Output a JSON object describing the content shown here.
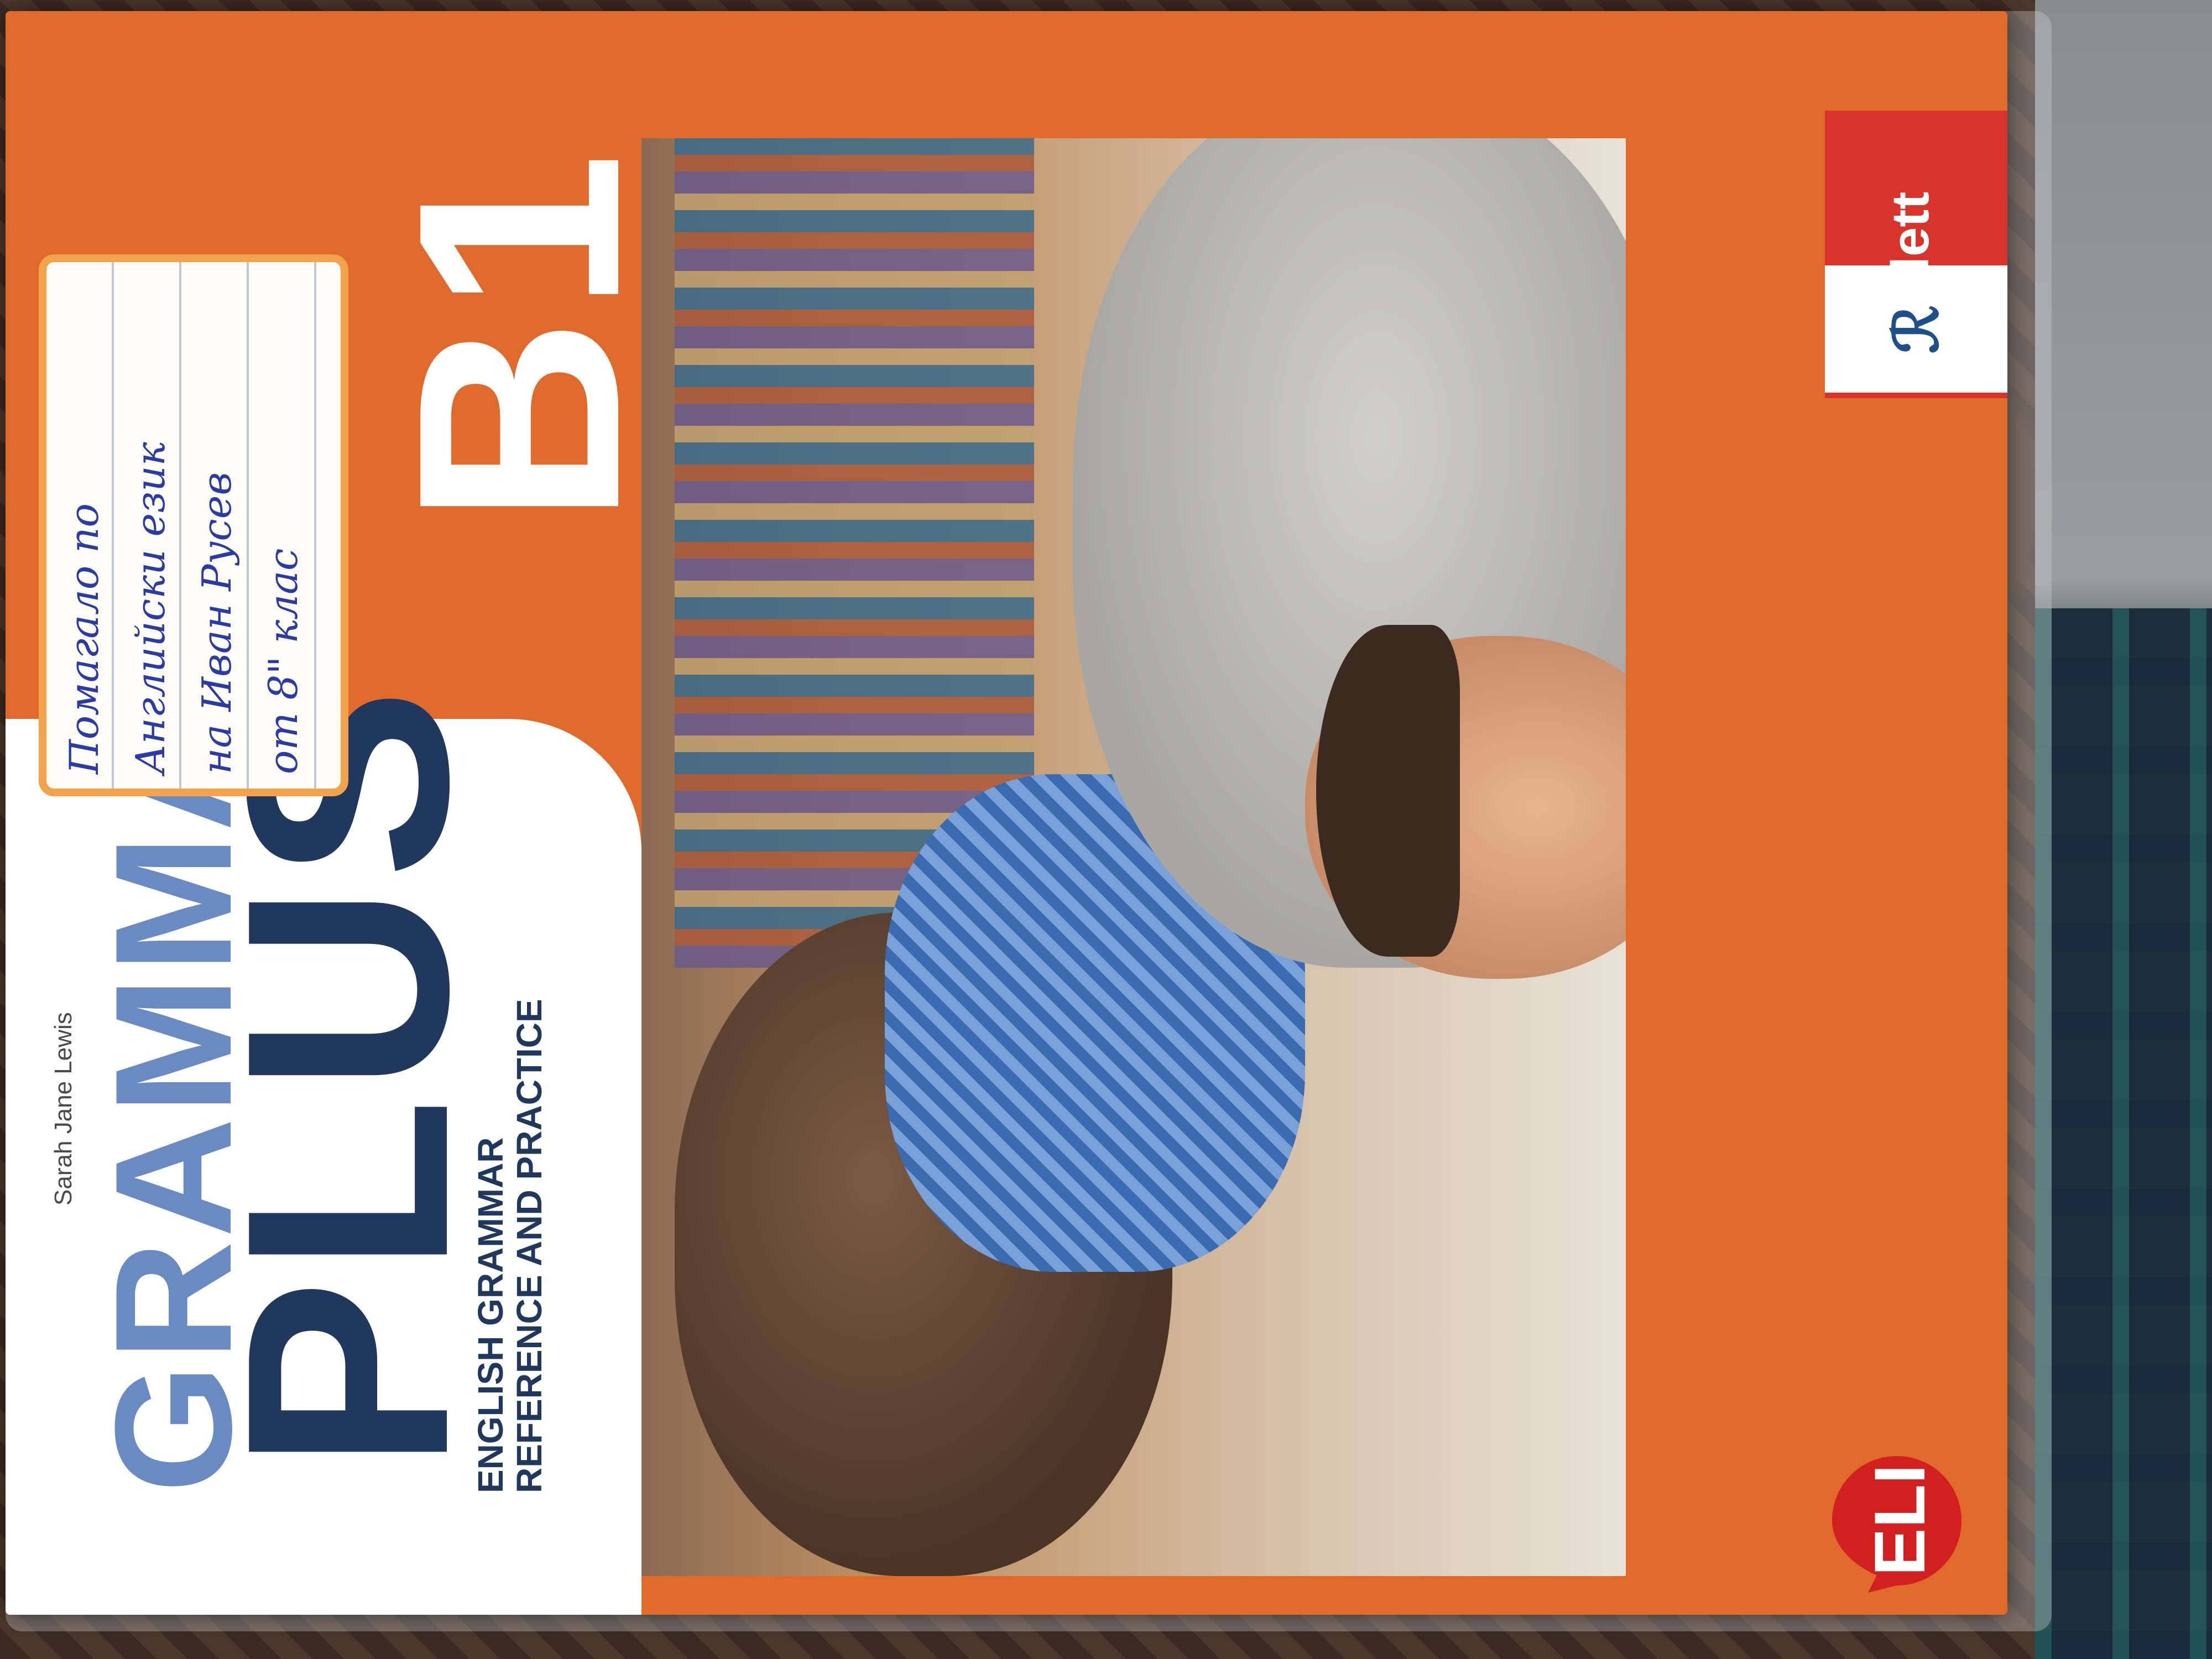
{
  "book": {
    "author": "Sarah Jane Lewis",
    "title_line1": "GRAMMAR",
    "title_line2": "PLUS",
    "level": "B1",
    "subtitle_line1": "ENGLISH GRAMMAR",
    "subtitle_line2": "REFERENCE AND PRACTICE",
    "publisher_logo": "Klett",
    "series_logo": "ELI"
  },
  "sticker": {
    "line1": "Помагало по",
    "line2": "Английски език",
    "line3": "на Иван Русев",
    "line4": "от 8\" клас"
  },
  "colors": {
    "cover_orange": "#e06a2c",
    "title_blue_light": "#6a8ac4",
    "title_navy": "#20385e",
    "klett_red": "#d9342b",
    "eli_red": "#d21f1f"
  }
}
